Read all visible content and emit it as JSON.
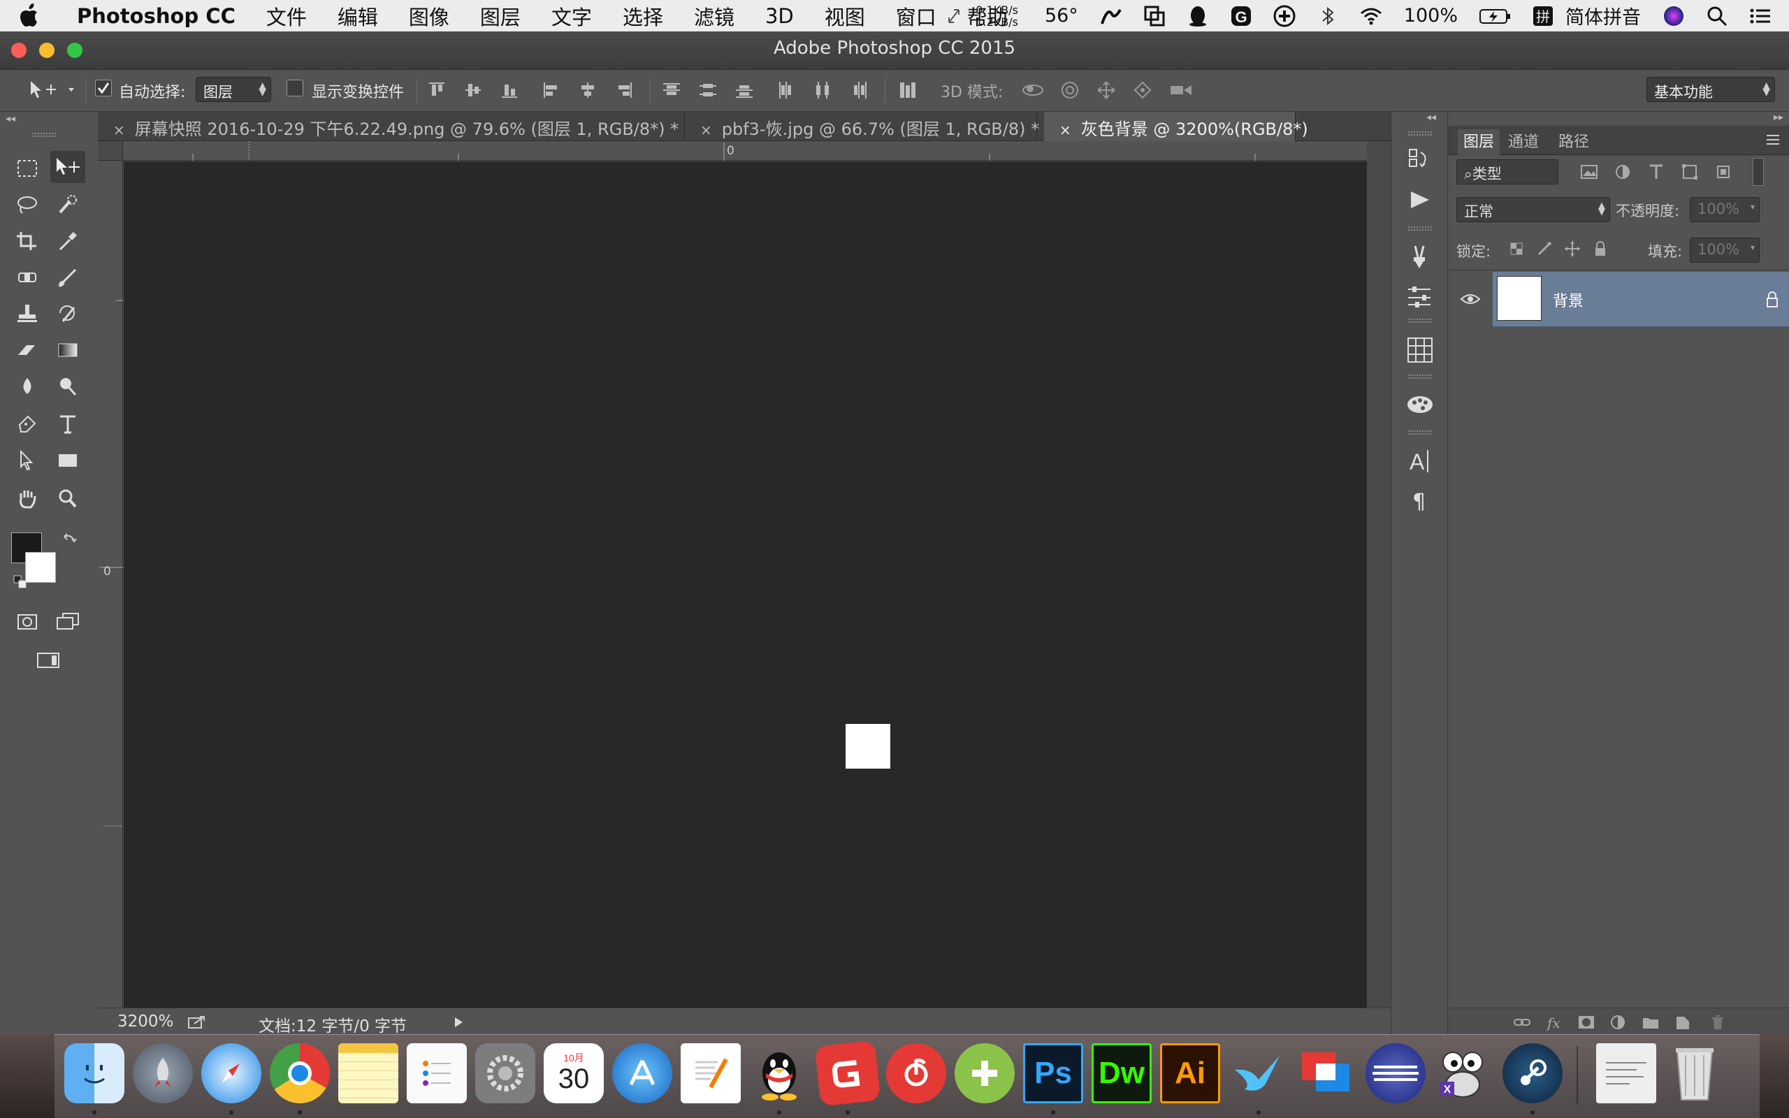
{
  "menubar": {
    "app_name": "Photoshop CC",
    "items": [
      "文件",
      "编辑",
      "图像",
      "图层",
      "文字",
      "选择",
      "滤镜",
      "3D",
      "视图",
      "窗口",
      "帮助"
    ],
    "net_up": "0.1KB/s",
    "net_down": "1.2KB/s",
    "temperature": "56°",
    "battery": "100%",
    "input_method": "简体拼音"
  },
  "window": {
    "title": "Adobe Photoshop CC 2015",
    "traffic_colors": [
      "#fc5f57",
      "#fdbc2e",
      "#33c748"
    ]
  },
  "options_bar": {
    "auto_select_label": "自动选择:",
    "auto_select_checked": true,
    "auto_select_value": "图层",
    "show_transform_label": "显示变换控件",
    "show_transform_checked": false,
    "mode_3d_label": "3D 模式:",
    "workspace_value": "基本功能"
  },
  "tabs": [
    {
      "label": "屏幕快照 2016-10-29 下午6.22.49.png @ 79.6% (图层 1, RGB/8*) *",
      "active": false
    },
    {
      "label": "pbf3-恢.jpg @ 66.7% (图层 1, RGB/8) *",
      "active": false
    },
    {
      "label": "灰色背景 @ 3200%(RGB/8*)",
      "active": true
    }
  ],
  "ruler": {
    "h_zero": "0",
    "v_zero": "0"
  },
  "status": {
    "zoom": "3200%",
    "doc_info": "文档:12 字节/0 字节"
  },
  "colors": {
    "foreground": "#1a1a1a",
    "background": "#ffffff",
    "canvas_bg": "#282828",
    "layer_selected": "#6a7d97"
  },
  "layers_panel": {
    "tabs": [
      "图层",
      "通道",
      "路径"
    ],
    "filter_kind": "类型",
    "blend_mode": "正常",
    "opacity_label": "不透明度:",
    "opacity_value": "100%",
    "lock_label": "锁定:",
    "fill_label": "填充:",
    "fill_value": "100%",
    "layers": [
      {
        "name": "背景",
        "locked": true,
        "visible": true
      }
    ]
  },
  "dock": {
    "apps": [
      {
        "name": "finder-icon",
        "label": ""
      },
      {
        "name": "launchpad-icon",
        "label": ""
      },
      {
        "name": "safari-icon",
        "label": ""
      },
      {
        "name": "chrome-icon",
        "label": ""
      },
      {
        "name": "notes-icon",
        "label": ""
      },
      {
        "name": "reminders-icon",
        "label": ""
      },
      {
        "name": "system-preferences-icon",
        "label": ""
      },
      {
        "name": "calendar-icon",
        "label": "30",
        "month": "10月"
      },
      {
        "name": "app-store-icon",
        "label": ""
      },
      {
        "name": "pages-icon",
        "label": ""
      },
      {
        "name": "qq-icon",
        "label": ""
      },
      {
        "name": "app-red-g-icon",
        "label": ""
      },
      {
        "name": "netease-music-icon",
        "label": ""
      },
      {
        "name": "green-plus-app-icon",
        "label": ""
      },
      {
        "name": "photoshop-icon",
        "label": "Ps"
      },
      {
        "name": "dreamweaver-icon",
        "label": "Dw"
      },
      {
        "name": "illustrator-icon",
        "label": "Ai"
      },
      {
        "name": "bird-app-icon",
        "label": ""
      },
      {
        "name": "parallels-icon",
        "label": ""
      },
      {
        "name": "eclipse-icon",
        "label": ""
      },
      {
        "name": "xquartz-icon",
        "label": ""
      },
      {
        "name": "steam-icon",
        "label": ""
      },
      {
        "name": "document-stack-icon",
        "label": ""
      },
      {
        "name": "trash-icon",
        "label": ""
      }
    ]
  }
}
